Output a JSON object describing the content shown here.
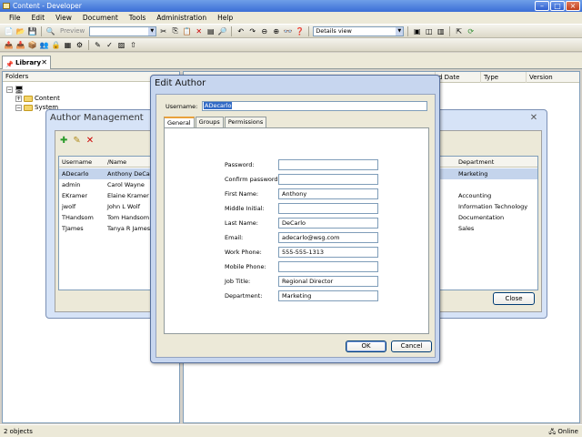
{
  "window": {
    "title": "Content - Developer"
  },
  "menu": [
    "File",
    "Edit",
    "View",
    "Document",
    "Tools",
    "Administration",
    "Help"
  ],
  "toolbar": {
    "preview_label": "Preview",
    "view_select": "Details view"
  },
  "library": {
    "tab_label": "Library",
    "folders_header": "Folders",
    "tree": [
      {
        "label": "Content",
        "level": 1
      },
      {
        "label": "System",
        "level": 1
      }
    ],
    "details_columns": [
      "d Date",
      "Type",
      "Version"
    ]
  },
  "status": {
    "objects": "2 objects",
    "connection": "Online"
  },
  "author_management": {
    "title": "Author Management",
    "columns": {
      "username": "Username",
      "name": "Name",
      "department": "Department"
    },
    "rows": [
      {
        "username": "ADecarlo",
        "name": "Anthony DeCarlo",
        "department": "Marketing",
        "selected": true
      },
      {
        "username": "admin",
        "name": "Carol Wayne",
        "department": ""
      },
      {
        "username": "EKramer",
        "name": "Elaine Kramer",
        "department": "Accounting"
      },
      {
        "username": "jwolf",
        "name": "John L Wolf",
        "department": "Information Technology"
      },
      {
        "username": "THandsom",
        "name": "Tom Handsom",
        "department": "Documentation"
      },
      {
        "username": "TJames",
        "name": "Tanya R James",
        "department": "Sales"
      }
    ],
    "close_label": "Close"
  },
  "edit_author": {
    "title": "Edit Author",
    "username_label": "Username:",
    "username_value": "ADecarlo",
    "tabs": [
      "General",
      "Groups",
      "Permissions"
    ],
    "fields": [
      {
        "label": "Password:",
        "value": ""
      },
      {
        "label": "Confirm password:",
        "value": ""
      },
      {
        "label": "First Name:",
        "value": "Anthony"
      },
      {
        "label": "Middle Initial:",
        "value": ""
      },
      {
        "label": "Last Name:",
        "value": "DeCarlo"
      },
      {
        "label": "Email:",
        "value": "adecarlo@wsg.com"
      },
      {
        "label": "Work Phone:",
        "value": "555-555-1313"
      },
      {
        "label": "Mobile Phone:",
        "value": ""
      },
      {
        "label": "Job Title:",
        "value": "Regional Director"
      },
      {
        "label": "Department:",
        "value": "Marketing"
      }
    ],
    "ok_label": "OK",
    "cancel_label": "Cancel"
  }
}
